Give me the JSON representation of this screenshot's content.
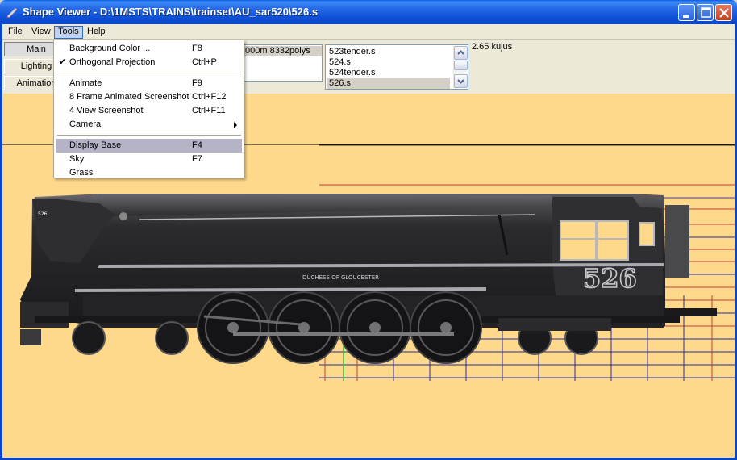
{
  "window": {
    "title": "Shape Viewer - D:\\1MSTS\\TRAINS\\trainset\\AU_sar520\\526.s"
  },
  "menubar": {
    "file": "File",
    "view": "View",
    "tools": "Tools",
    "help": "Help"
  },
  "tabs": {
    "main": "Main",
    "lighting": "Lighting",
    "animation": "Animation"
  },
  "stats": {
    "text": "000m 8332polys"
  },
  "shape_list": {
    "items": [
      "523tender.s",
      "524.s",
      "524tender.s",
      "526.s"
    ],
    "selected": "526.s"
  },
  "info": {
    "kujus": "2.65 kujus"
  },
  "tools_menu": {
    "background_color": {
      "label": "Background Color ...",
      "shortcut": "F8"
    },
    "orthogonal_projection": {
      "label": "Orthogonal Projection",
      "shortcut": "Ctrl+P",
      "checked": true
    },
    "animate": {
      "label": "Animate",
      "shortcut": "F9"
    },
    "frame_screenshot": {
      "label": "8 Frame Animated Screenshot",
      "shortcut": "Ctrl+F12"
    },
    "view_screenshot": {
      "label": "4 View Screenshot",
      "shortcut": "Ctrl+F11"
    },
    "camera": {
      "label": "Camera"
    },
    "display_base": {
      "label": "Display Base",
      "shortcut": "F4"
    },
    "sky": {
      "label": "Sky",
      "shortcut": "F7"
    },
    "grass": {
      "label": "Grass"
    }
  },
  "locomotive": {
    "number": "526",
    "name": "DUCHESS OF GLOUCESTER",
    "smokebox_plate": "526"
  },
  "colors": {
    "title_bar": "#0f52d8",
    "viewport_background": "#fed98c",
    "menu_highlight": "#b4b4c6",
    "locomotive_body": "#2b2b2d"
  }
}
